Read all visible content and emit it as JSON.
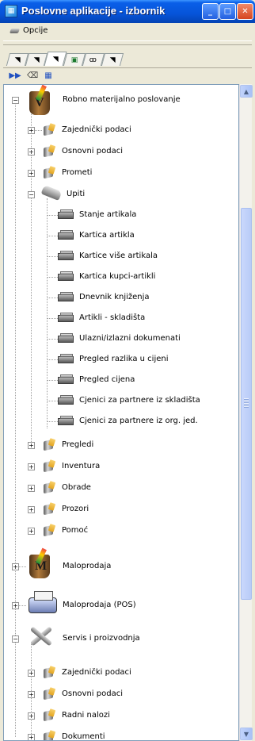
{
  "window": {
    "title": "Poslovne aplikacije - izbornik"
  },
  "menu": {
    "opcije": "Opcije"
  },
  "tree": {
    "robno": "Robno materijalno poslovanje",
    "zajednicki": "Zajednički podaci",
    "osnovni": "Osnovni podaci",
    "prometi": "Prometi",
    "upiti": "Upiti",
    "upiti_items": [
      "Stanje artikala",
      "Kartica artikla",
      "Kartice više artikala",
      "Kartica kupci-artikli",
      "Dnevnik knjiženja",
      "Artikli - skladišta",
      "Ulazni/izlazni dokumenati",
      "Pregled razlika u cijeni",
      "Pregled cijena",
      "Cjenici za partnere iz skladišta",
      "Cjenici za partnere iz org. jed."
    ],
    "pregledi": "Pregledi",
    "inventura": "Inventura",
    "obrade": "Obrade",
    "prozori": "Prozori",
    "pomoc": "Pomoć",
    "maloprodaja": "Maloprodaja",
    "maloprodaja_pos": "Maloprodaja (POS)",
    "servis": "Servis i proizvodnja",
    "servis_zajednicki": "Zajednički podaci",
    "servis_osnovni": "Osnovni podaci",
    "radni_nalozi": "Radni nalozi",
    "dokumenti": "Dokumenti"
  }
}
